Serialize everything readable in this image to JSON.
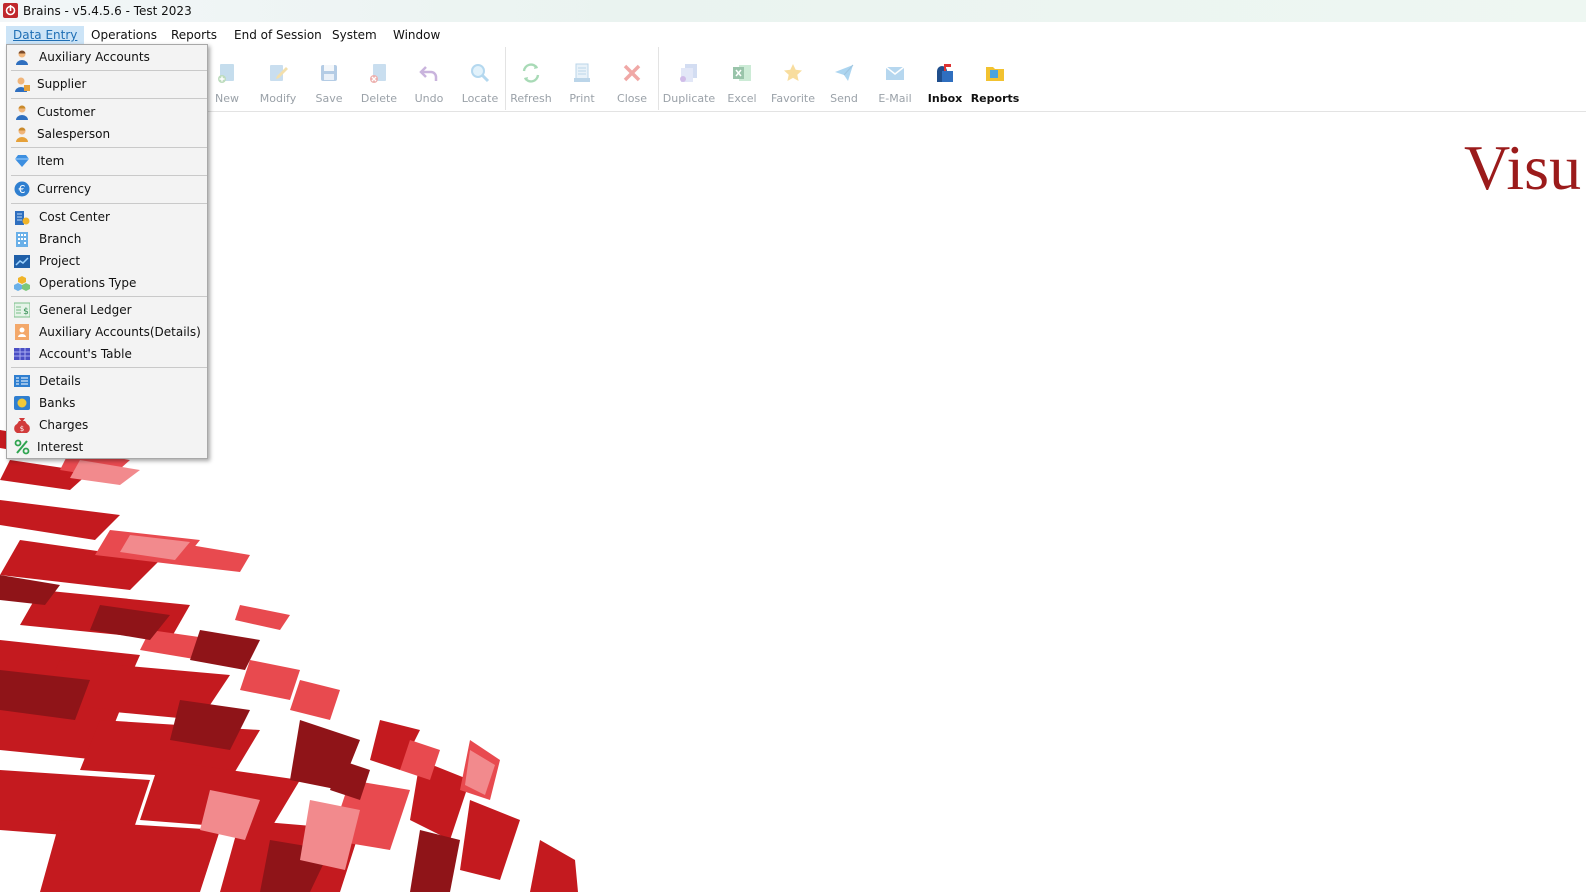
{
  "window": {
    "title": "Brains - v5.4.5.6 - Test 2023"
  },
  "menubar": {
    "items": [
      "Data Entry",
      "Operations",
      "Reports",
      "End of Session",
      "System",
      "Window"
    ]
  },
  "toolbar": {
    "buttons": [
      {
        "label": "New",
        "icon": "new-icon"
      },
      {
        "label": "Modify",
        "icon": "modify-icon"
      },
      {
        "label": "Save",
        "icon": "save-icon"
      },
      {
        "label": "Delete",
        "icon": "delete-icon"
      },
      {
        "label": "Undo",
        "icon": "undo-icon"
      },
      {
        "label": "Locate",
        "icon": "locate-icon"
      },
      {
        "label": "Refresh",
        "icon": "refresh-icon"
      },
      {
        "label": "Print",
        "icon": "print-icon"
      },
      {
        "label": "Close",
        "icon": "close-icon"
      },
      {
        "label": "Duplicate",
        "icon": "duplicate-icon"
      },
      {
        "label": "Excel",
        "icon": "excel-icon"
      },
      {
        "label": "Favorite",
        "icon": "favorite-icon"
      },
      {
        "label": "Send",
        "icon": "send-icon"
      },
      {
        "label": "E-Mail",
        "icon": "email-icon"
      },
      {
        "label": "Inbox",
        "icon": "inbox-icon"
      },
      {
        "label": "Reports",
        "icon": "reports-icon"
      }
    ]
  },
  "dropdown": {
    "items": [
      {
        "label": "Auxiliary Accounts",
        "icon": "person-icon"
      },
      {
        "label": "Supplier",
        "icon": "supplier-icon"
      },
      {
        "label": "Customer",
        "icon": "customer-icon"
      },
      {
        "label": "Salesperson",
        "icon": "salesperson-icon"
      },
      {
        "label": "Item",
        "icon": "gem-icon"
      },
      {
        "label": "Currency",
        "icon": "euro-icon"
      },
      {
        "label": "Cost Center",
        "icon": "cost-center-icon"
      },
      {
        "label": "Branch",
        "icon": "building-icon"
      },
      {
        "label": "Project",
        "icon": "chart-icon"
      },
      {
        "label": "Operations Type",
        "icon": "cubes-icon"
      },
      {
        "label": "General Ledger",
        "icon": "ledger-icon"
      },
      {
        "label": "Auxiliary Accounts(Details)",
        "icon": "person-card-icon"
      },
      {
        "label": "Account's Table",
        "icon": "table-icon"
      },
      {
        "label": "Details",
        "icon": "details-icon"
      },
      {
        "label": "Banks",
        "icon": "bank-icon"
      },
      {
        "label": "Charges",
        "icon": "money-bag-icon"
      },
      {
        "label": "Interest",
        "icon": "percent-icon"
      }
    ]
  },
  "background": {
    "visual_text": "Visu",
    "accent": "#9b1b1b"
  }
}
